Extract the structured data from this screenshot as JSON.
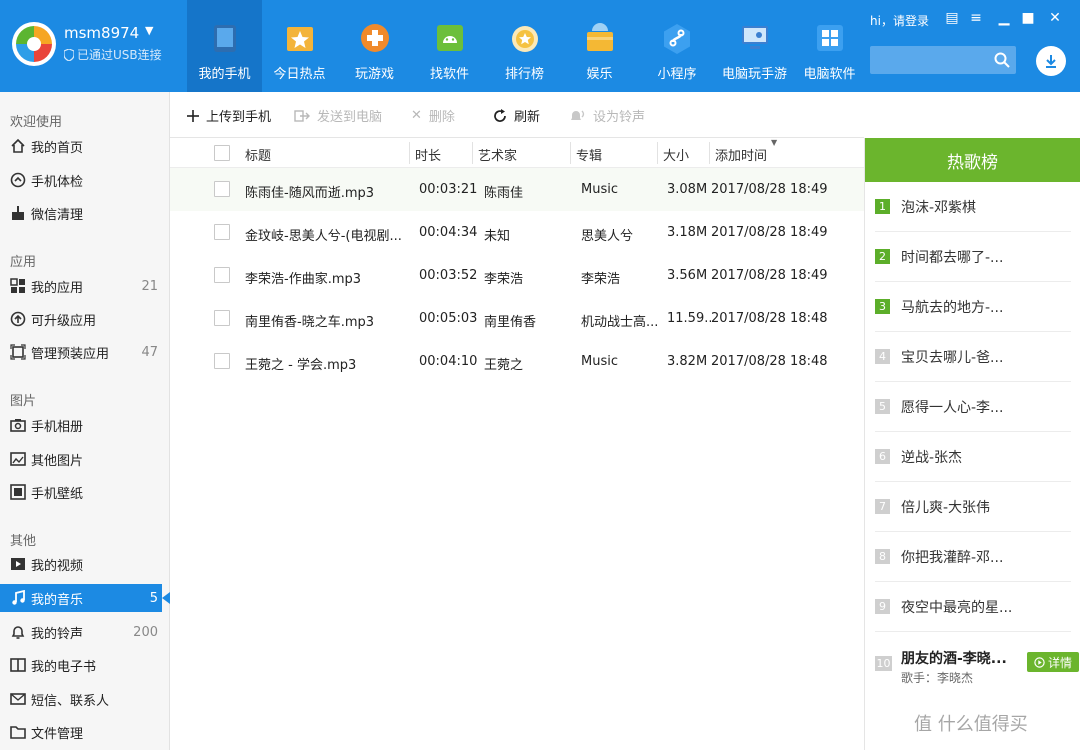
{
  "device": {
    "name": "msm8974",
    "connection": "已通过USB连接"
  },
  "nav": [
    {
      "label": "我的手机",
      "icon": "phone-icon",
      "color": "#4d8cc8"
    },
    {
      "label": "今日热点",
      "icon": "star-hot-icon",
      "color": "#f3b43a"
    },
    {
      "label": "玩游戏",
      "icon": "gamepad-icon",
      "color": "#f08a2b"
    },
    {
      "label": "找软件",
      "icon": "android-app-icon",
      "color": "#6cbf3a"
    },
    {
      "label": "排行榜",
      "icon": "medal-icon",
      "color": "#f5c242"
    },
    {
      "label": "娱乐",
      "icon": "folder-icon",
      "color": "#f4b834"
    },
    {
      "label": "小程序",
      "icon": "mini-program-icon",
      "color": "#3ca0f0"
    },
    {
      "label": "电脑玩手游",
      "icon": "pc-game-icon",
      "color": "#3c7fd0"
    },
    {
      "label": "电脑软件",
      "icon": "pc-software-icon",
      "color": "#3ca0f0"
    }
  ],
  "topbar": {
    "greeting": "hi，请登录",
    "search_placeholder": ""
  },
  "sidebar": {
    "sections": [
      {
        "title": "欢迎使用",
        "items": [
          {
            "label": "我的首页",
            "icon": "home-icon",
            "count": ""
          },
          {
            "label": "手机体检",
            "icon": "checkup-icon",
            "count": ""
          },
          {
            "label": "微信清理",
            "icon": "broom-icon",
            "count": ""
          }
        ]
      },
      {
        "title": "应用",
        "items": [
          {
            "label": "我的应用",
            "icon": "apps-grid-icon",
            "count": "21"
          },
          {
            "label": "可升级应用",
            "icon": "upgrade-icon",
            "count": ""
          },
          {
            "label": "管理预装应用",
            "icon": "preinstalled-icon",
            "count": "47"
          }
        ]
      },
      {
        "title": "图片",
        "items": [
          {
            "label": "手机相册",
            "icon": "camera-icon",
            "count": ""
          },
          {
            "label": "其他图片",
            "icon": "image-icon",
            "count": ""
          },
          {
            "label": "手机壁纸",
            "icon": "wallpaper-icon",
            "count": ""
          }
        ]
      },
      {
        "title": "其他",
        "items": [
          {
            "label": "我的视频",
            "icon": "video-icon",
            "count": ""
          },
          {
            "label": "我的音乐",
            "icon": "music-icon",
            "count": "5",
            "active": true
          },
          {
            "label": "我的铃声",
            "icon": "bell-icon",
            "count": "200"
          },
          {
            "label": "我的电子书",
            "icon": "book-icon",
            "count": ""
          },
          {
            "label": "短信、联系人",
            "icon": "mail-icon",
            "count": ""
          },
          {
            "label": "文件管理",
            "icon": "folder-file-icon",
            "count": ""
          }
        ]
      }
    ]
  },
  "toolbar": {
    "upload": "上传到手机",
    "send_pc": "发送到电脑",
    "delete": "删除",
    "refresh": "刷新",
    "ringtone": "设为铃声"
  },
  "table": {
    "headers": {
      "title": "标题",
      "duration": "时长",
      "artist": "艺术家",
      "album": "专辑",
      "size": "大小",
      "added": "添加时间"
    },
    "rows": [
      {
        "title": "陈雨佳-随风而逝.mp3",
        "duration": "00:03:21",
        "artist": "陈雨佳",
        "album": "Music",
        "size": "3.08M",
        "added": "2017/08/28 18:49"
      },
      {
        "title": "金玟岐-思美人兮-(电视剧...",
        "duration": "00:04:34",
        "artist": "未知",
        "album": "思美人兮",
        "size": "3.18M",
        "added": "2017/08/28 18:49"
      },
      {
        "title": "李荣浩-作曲家.mp3",
        "duration": "00:03:52",
        "artist": "李荣浩",
        "album": "李荣浩",
        "size": "3.56M",
        "added": "2017/08/28 18:49"
      },
      {
        "title": "南里侑香-晓之车.mp3",
        "duration": "00:05:03",
        "artist": "南里侑香",
        "album": "机动战士高...",
        "size": "11.59...",
        "added": "2017/08/28 18:48"
      },
      {
        "title": "王菀之 - 学会.mp3",
        "duration": "00:04:10",
        "artist": "王菀之",
        "album": "Music",
        "size": "3.82M",
        "added": "2017/08/28 18:48"
      }
    ]
  },
  "hot": {
    "title": "热歌榜",
    "items": [
      {
        "rank": "1",
        "name": "泡沫-邓紫棋"
      },
      {
        "rank": "2",
        "name": "时间都去哪了-..."
      },
      {
        "rank": "3",
        "name": "马航去的地方-..."
      },
      {
        "rank": "4",
        "name": "宝贝去哪儿-爸..."
      },
      {
        "rank": "5",
        "name": "愿得一人心-李..."
      },
      {
        "rank": "6",
        "name": "逆战-张杰"
      },
      {
        "rank": "7",
        "name": "倍儿爽-大张伟"
      },
      {
        "rank": "8",
        "name": "你把我灌醉-邓..."
      },
      {
        "rank": "9",
        "name": "夜空中最亮的星..."
      }
    ],
    "featured": {
      "rank": "10",
      "name": "朋友的酒-李晓...",
      "singer": "歌手：李晓杰",
      "detail": "详情"
    }
  },
  "watermark": "值 什么值得买",
  "colors": {
    "header": "#1c8ae3",
    "accent_green": "#6bb52d",
    "active_nav": "#1575c9"
  }
}
